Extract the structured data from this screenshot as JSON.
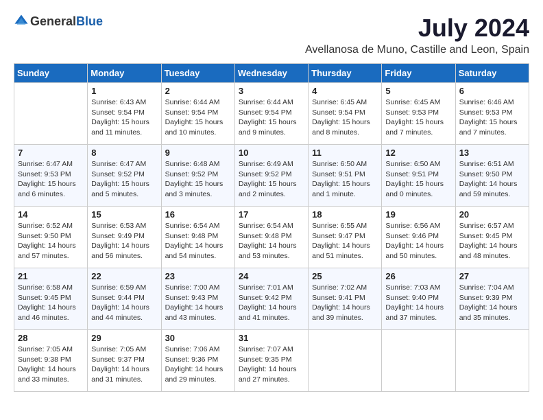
{
  "logo": {
    "general": "General",
    "blue": "Blue"
  },
  "title": "July 2024",
  "location": "Avellanosa de Muno, Castille and Leon, Spain",
  "headers": [
    "Sunday",
    "Monday",
    "Tuesday",
    "Wednesday",
    "Thursday",
    "Friday",
    "Saturday"
  ],
  "weeks": [
    [
      {
        "day": "",
        "sunrise": "",
        "sunset": "",
        "daylight": ""
      },
      {
        "day": "1",
        "sunrise": "Sunrise: 6:43 AM",
        "sunset": "Sunset: 9:54 PM",
        "daylight": "Daylight: 15 hours and 11 minutes."
      },
      {
        "day": "2",
        "sunrise": "Sunrise: 6:44 AM",
        "sunset": "Sunset: 9:54 PM",
        "daylight": "Daylight: 15 hours and 10 minutes."
      },
      {
        "day": "3",
        "sunrise": "Sunrise: 6:44 AM",
        "sunset": "Sunset: 9:54 PM",
        "daylight": "Daylight: 15 hours and 9 minutes."
      },
      {
        "day": "4",
        "sunrise": "Sunrise: 6:45 AM",
        "sunset": "Sunset: 9:54 PM",
        "daylight": "Daylight: 15 hours and 8 minutes."
      },
      {
        "day": "5",
        "sunrise": "Sunrise: 6:45 AM",
        "sunset": "Sunset: 9:53 PM",
        "daylight": "Daylight: 15 hours and 7 minutes."
      },
      {
        "day": "6",
        "sunrise": "Sunrise: 6:46 AM",
        "sunset": "Sunset: 9:53 PM",
        "daylight": "Daylight: 15 hours and 7 minutes."
      }
    ],
    [
      {
        "day": "7",
        "sunrise": "Sunrise: 6:47 AM",
        "sunset": "Sunset: 9:53 PM",
        "daylight": "Daylight: 15 hours and 6 minutes."
      },
      {
        "day": "8",
        "sunrise": "Sunrise: 6:47 AM",
        "sunset": "Sunset: 9:52 PM",
        "daylight": "Daylight: 15 hours and 5 minutes."
      },
      {
        "day": "9",
        "sunrise": "Sunrise: 6:48 AM",
        "sunset": "Sunset: 9:52 PM",
        "daylight": "Daylight: 15 hours and 3 minutes."
      },
      {
        "day": "10",
        "sunrise": "Sunrise: 6:49 AM",
        "sunset": "Sunset: 9:52 PM",
        "daylight": "Daylight: 15 hours and 2 minutes."
      },
      {
        "day": "11",
        "sunrise": "Sunrise: 6:50 AM",
        "sunset": "Sunset: 9:51 PM",
        "daylight": "Daylight: 15 hours and 1 minute."
      },
      {
        "day": "12",
        "sunrise": "Sunrise: 6:50 AM",
        "sunset": "Sunset: 9:51 PM",
        "daylight": "Daylight: 15 hours and 0 minutes."
      },
      {
        "day": "13",
        "sunrise": "Sunrise: 6:51 AM",
        "sunset": "Sunset: 9:50 PM",
        "daylight": "Daylight: 14 hours and 59 minutes."
      }
    ],
    [
      {
        "day": "14",
        "sunrise": "Sunrise: 6:52 AM",
        "sunset": "Sunset: 9:50 PM",
        "daylight": "Daylight: 14 hours and 57 minutes."
      },
      {
        "day": "15",
        "sunrise": "Sunrise: 6:53 AM",
        "sunset": "Sunset: 9:49 PM",
        "daylight": "Daylight: 14 hours and 56 minutes."
      },
      {
        "day": "16",
        "sunrise": "Sunrise: 6:54 AM",
        "sunset": "Sunset: 9:48 PM",
        "daylight": "Daylight: 14 hours and 54 minutes."
      },
      {
        "day": "17",
        "sunrise": "Sunrise: 6:54 AM",
        "sunset": "Sunset: 9:48 PM",
        "daylight": "Daylight: 14 hours and 53 minutes."
      },
      {
        "day": "18",
        "sunrise": "Sunrise: 6:55 AM",
        "sunset": "Sunset: 9:47 PM",
        "daylight": "Daylight: 14 hours and 51 minutes."
      },
      {
        "day": "19",
        "sunrise": "Sunrise: 6:56 AM",
        "sunset": "Sunset: 9:46 PM",
        "daylight": "Daylight: 14 hours and 50 minutes."
      },
      {
        "day": "20",
        "sunrise": "Sunrise: 6:57 AM",
        "sunset": "Sunset: 9:45 PM",
        "daylight": "Daylight: 14 hours and 48 minutes."
      }
    ],
    [
      {
        "day": "21",
        "sunrise": "Sunrise: 6:58 AM",
        "sunset": "Sunset: 9:45 PM",
        "daylight": "Daylight: 14 hours and 46 minutes."
      },
      {
        "day": "22",
        "sunrise": "Sunrise: 6:59 AM",
        "sunset": "Sunset: 9:44 PM",
        "daylight": "Daylight: 14 hours and 44 minutes."
      },
      {
        "day": "23",
        "sunrise": "Sunrise: 7:00 AM",
        "sunset": "Sunset: 9:43 PM",
        "daylight": "Daylight: 14 hours and 43 minutes."
      },
      {
        "day": "24",
        "sunrise": "Sunrise: 7:01 AM",
        "sunset": "Sunset: 9:42 PM",
        "daylight": "Daylight: 14 hours and 41 minutes."
      },
      {
        "day": "25",
        "sunrise": "Sunrise: 7:02 AM",
        "sunset": "Sunset: 9:41 PM",
        "daylight": "Daylight: 14 hours and 39 minutes."
      },
      {
        "day": "26",
        "sunrise": "Sunrise: 7:03 AM",
        "sunset": "Sunset: 9:40 PM",
        "daylight": "Daylight: 14 hours and 37 minutes."
      },
      {
        "day": "27",
        "sunrise": "Sunrise: 7:04 AM",
        "sunset": "Sunset: 9:39 PM",
        "daylight": "Daylight: 14 hours and 35 minutes."
      }
    ],
    [
      {
        "day": "28",
        "sunrise": "Sunrise: 7:05 AM",
        "sunset": "Sunset: 9:38 PM",
        "daylight": "Daylight: 14 hours and 33 minutes."
      },
      {
        "day": "29",
        "sunrise": "Sunrise: 7:05 AM",
        "sunset": "Sunset: 9:37 PM",
        "daylight": "Daylight: 14 hours and 31 minutes."
      },
      {
        "day": "30",
        "sunrise": "Sunrise: 7:06 AM",
        "sunset": "Sunset: 9:36 PM",
        "daylight": "Daylight: 14 hours and 29 minutes."
      },
      {
        "day": "31",
        "sunrise": "Sunrise: 7:07 AM",
        "sunset": "Sunset: 9:35 PM",
        "daylight": "Daylight: 14 hours and 27 minutes."
      },
      {
        "day": "",
        "sunrise": "",
        "sunset": "",
        "daylight": ""
      },
      {
        "day": "",
        "sunrise": "",
        "sunset": "",
        "daylight": ""
      },
      {
        "day": "",
        "sunrise": "",
        "sunset": "",
        "daylight": ""
      }
    ]
  ]
}
